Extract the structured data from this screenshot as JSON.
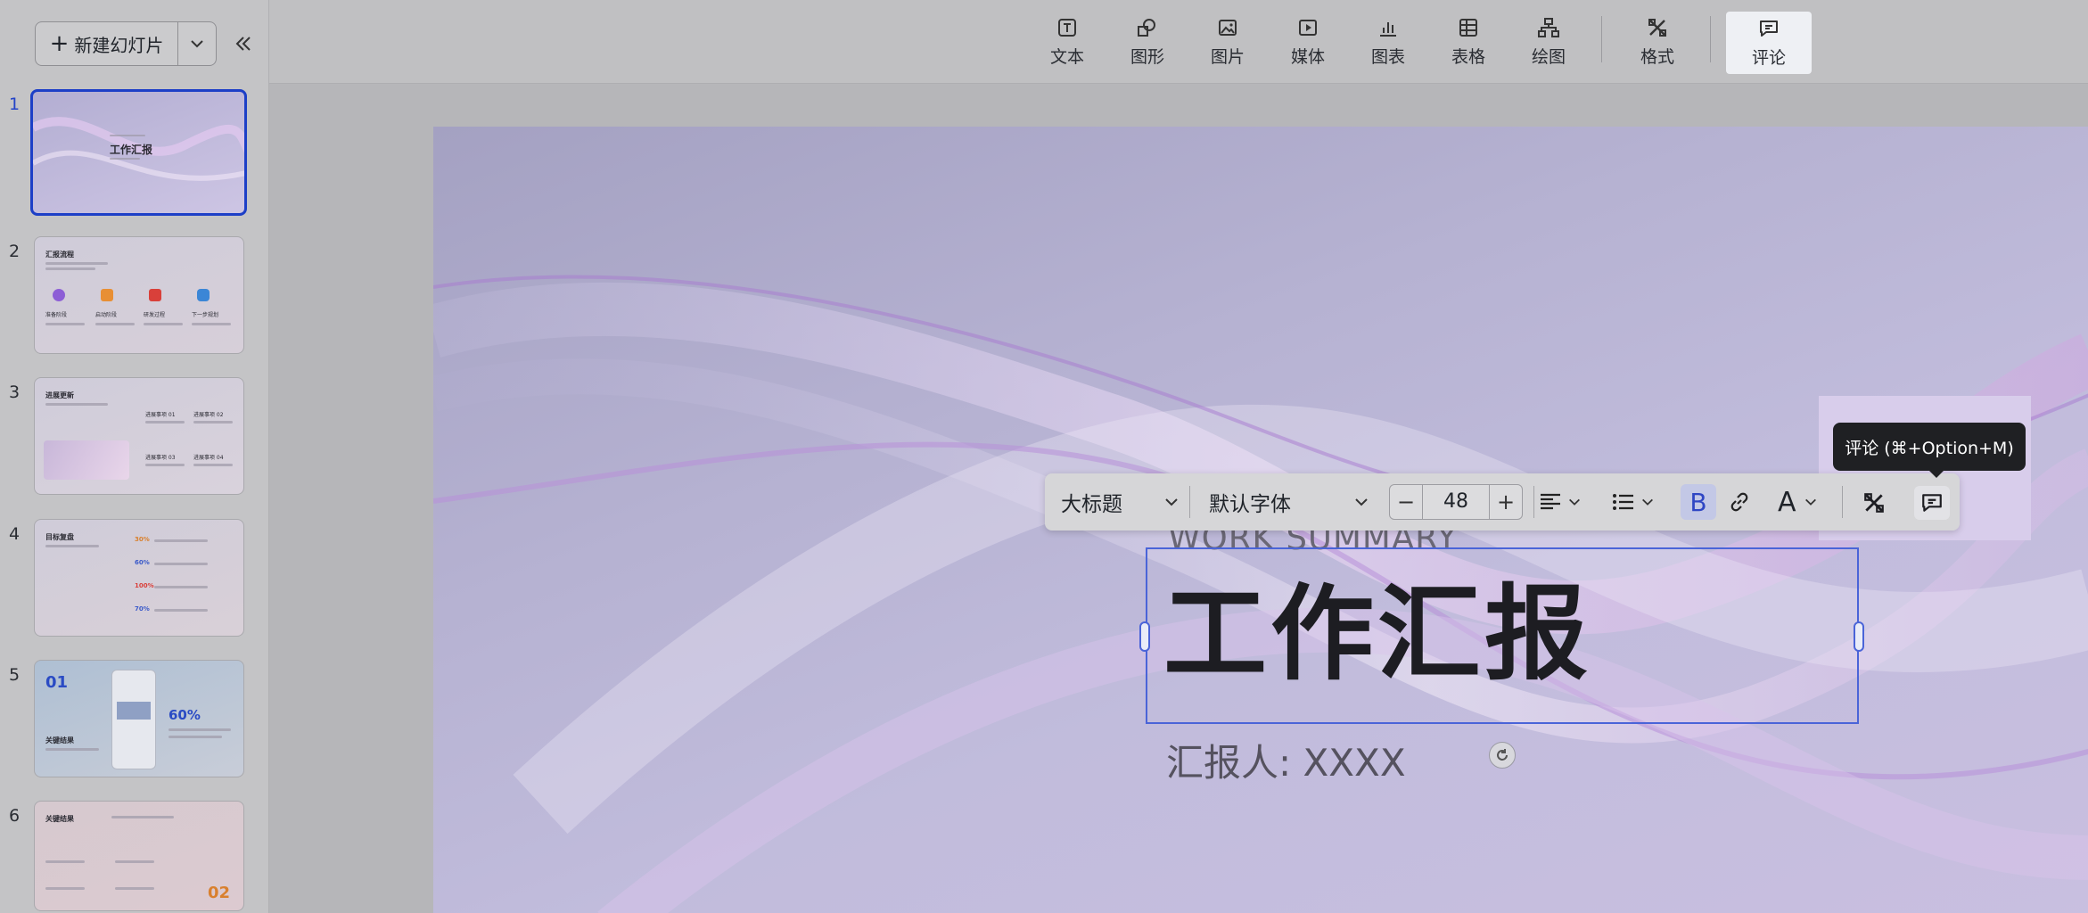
{
  "sidebar": {
    "new_slide_label": "新建幻灯片",
    "slides": [
      {
        "num": "1",
        "title": "工作汇报"
      },
      {
        "num": "2",
        "title": "汇报流程",
        "labels": [
          "准备阶段",
          "启动阶段",
          "研发过程",
          "下一步规划"
        ]
      },
      {
        "num": "3",
        "title": "进展更新",
        "labels": [
          "进展事项 01",
          "进展事项 02",
          "进展事项 03",
          "进展事项 04"
        ]
      },
      {
        "num": "4",
        "title": "目标复盘",
        "labels": [
          "30%",
          "60%",
          "100%",
          "70%"
        ]
      },
      {
        "num": "5",
        "title": "关键结果",
        "big": "01",
        "pct": "60%"
      },
      {
        "num": "6",
        "title": "关键结果",
        "big": "02"
      }
    ]
  },
  "toolbar": {
    "items": [
      "文本",
      "图形",
      "图片",
      "媒体",
      "图表",
      "表格",
      "绘图",
      "格式",
      "评论"
    ]
  },
  "slide": {
    "subtitle_en": "WORK SUMMARY",
    "title": "工作汇报",
    "reporter": "汇报人: XXXX"
  },
  "format_bar": {
    "style": "大标题",
    "font": "默认字体",
    "size": "48",
    "bold": "B",
    "text_color": "A"
  },
  "tooltip": "评论 (⌘+Option+M)",
  "colors": {
    "accent": "#2444c8",
    "selection": "#4a64d8",
    "tooltip_bg": "#1f2023"
  }
}
